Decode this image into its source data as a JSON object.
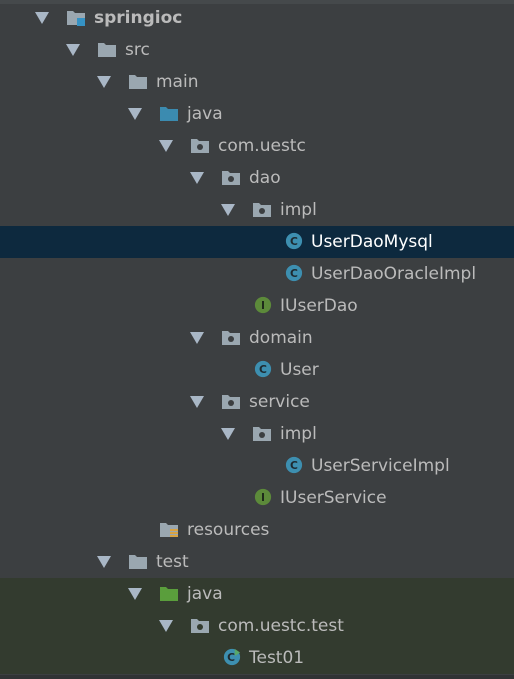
{
  "project_tree": {
    "root": {
      "label": "springioc",
      "icon": "module-folder-icon"
    },
    "src": {
      "label": "src",
      "icon": "folder-icon"
    },
    "main": {
      "label": "main",
      "icon": "folder-icon"
    },
    "main_java": {
      "label": "java",
      "icon": "source-root-folder-icon"
    },
    "com_uestc": {
      "label": "com.uestc",
      "icon": "package-icon"
    },
    "dao": {
      "label": "dao",
      "icon": "package-icon"
    },
    "dao_impl": {
      "label": "impl",
      "icon": "package-icon"
    },
    "user_dao_mysql": {
      "label": "UserDaoMysql",
      "icon": "class-icon",
      "selected": true
    },
    "user_dao_oracle_impl": {
      "label": "UserDaoOracleImpl",
      "icon": "class-icon"
    },
    "i_user_dao": {
      "label": "IUserDao",
      "icon": "interface-icon"
    },
    "domain": {
      "label": "domain",
      "icon": "package-icon"
    },
    "user": {
      "label": "User",
      "icon": "class-icon"
    },
    "service": {
      "label": "service",
      "icon": "package-icon"
    },
    "service_impl": {
      "label": "impl",
      "icon": "package-icon"
    },
    "user_service_impl": {
      "label": "UserServiceImpl",
      "icon": "class-icon"
    },
    "i_user_service": {
      "label": "IUserService",
      "icon": "interface-icon"
    },
    "resources": {
      "label": "resources",
      "icon": "resources-folder-icon"
    },
    "test": {
      "label": "test",
      "icon": "folder-icon"
    },
    "test_java": {
      "label": "java",
      "icon": "test-source-root-folder-icon"
    },
    "com_uestc_test": {
      "label": "com.uestc.test",
      "icon": "package-icon"
    },
    "test01": {
      "label": "Test01",
      "icon": "runnable-class-icon"
    }
  },
  "colors": {
    "background": "#3c3f41",
    "selection": "#0d293e",
    "test_source_highlight": "#333b2f",
    "class_icon": "#3d8fb0",
    "interface_icon": "#5c8a3a",
    "source_root_folder": "#3b8bb0",
    "test_root_folder": "#5a9e3c"
  }
}
